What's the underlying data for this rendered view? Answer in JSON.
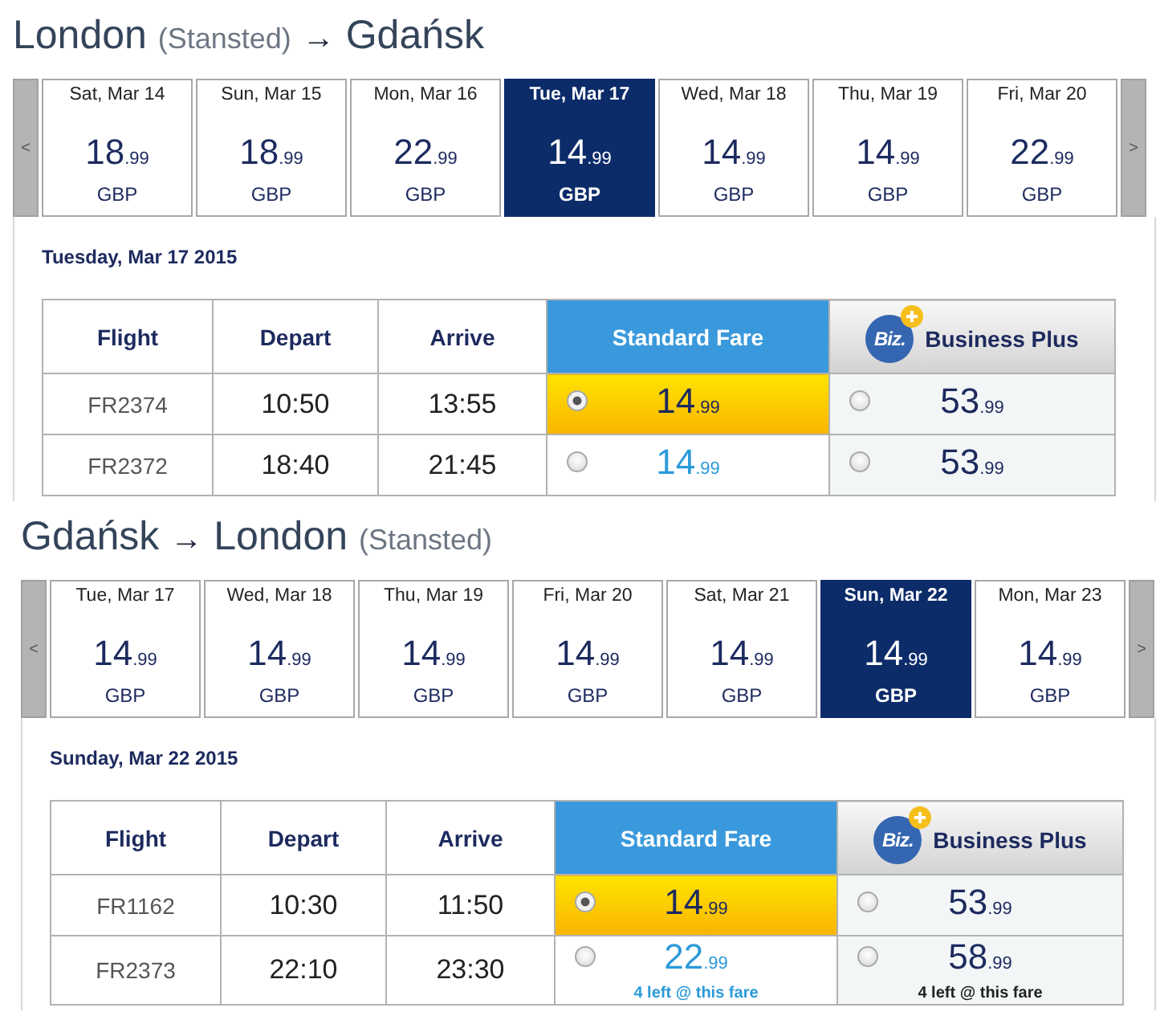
{
  "sections": [
    {
      "title": [
        {
          "kind": "city",
          "text": "London"
        },
        {
          "kind": "airport",
          "text": "(Stansted)"
        },
        {
          "kind": "arrow",
          "text": "→"
        },
        {
          "kind": "city",
          "text": "Gdańsk"
        }
      ],
      "prev_label": "<",
      "next_label": ">",
      "dates": [
        {
          "label": "Sat, Mar 14",
          "price": "18",
          "cents": ".99",
          "currency": "GBP",
          "selected": false
        },
        {
          "label": "Sun, Mar 15",
          "price": "18",
          "cents": ".99",
          "currency": "GBP",
          "selected": false
        },
        {
          "label": "Mon, Mar 16",
          "price": "22",
          "cents": ".99",
          "currency": "GBP",
          "selected": false
        },
        {
          "label": "Tue, Mar 17",
          "price": "14",
          "cents": ".99",
          "currency": "GBP",
          "selected": true
        },
        {
          "label": "Wed, Mar 18",
          "price": "14",
          "cents": ".99",
          "currency": "GBP",
          "selected": false
        },
        {
          "label": "Thu, Mar 19",
          "price": "14",
          "cents": ".99",
          "currency": "GBP",
          "selected": false
        },
        {
          "label": "Fri, Mar 20",
          "price": "22",
          "cents": ".99",
          "currency": "GBP",
          "selected": false
        }
      ],
      "day_heading": "Tuesday, Mar 17 2015",
      "columns": [
        {
          "label": "Flight",
          "kind": "info"
        },
        {
          "label": "Depart",
          "kind": "info"
        },
        {
          "label": "Arrive",
          "kind": "info"
        },
        {
          "label": "Standard Fare",
          "kind": "standard"
        },
        {
          "label": "Business Plus",
          "kind": "business",
          "logo_text": "Biz."
        }
      ],
      "rows": [
        {
          "flight": "FR2374",
          "depart": "10:50",
          "arrive": "13:55",
          "fares": [
            {
              "price": "14",
              "cents": ".99",
              "selected": true
            },
            {
              "price": "53",
              "cents": ".99",
              "selected": false
            }
          ]
        },
        {
          "flight": "FR2372",
          "depart": "18:40",
          "arrive": "21:45",
          "fares": [
            {
              "price": "14",
              "cents": ".99",
              "selected": false
            },
            {
              "price": "53",
              "cents": ".99",
              "selected": false
            }
          ]
        }
      ]
    },
    {
      "title": [
        {
          "kind": "city",
          "text": "Gdańsk"
        },
        {
          "kind": "arrow",
          "text": "→"
        },
        {
          "kind": "city",
          "text": "London"
        },
        {
          "kind": "airport",
          "text": "(Stansted)"
        }
      ],
      "prev_label": "<",
      "next_label": ">",
      "dates": [
        {
          "label": "Tue, Mar 17",
          "price": "14",
          "cents": ".99",
          "currency": "GBP",
          "selected": false
        },
        {
          "label": "Wed, Mar 18",
          "price": "14",
          "cents": ".99",
          "currency": "GBP",
          "selected": false
        },
        {
          "label": "Thu, Mar 19",
          "price": "14",
          "cents": ".99",
          "currency": "GBP",
          "selected": false
        },
        {
          "label": "Fri, Mar 20",
          "price": "14",
          "cents": ".99",
          "currency": "GBP",
          "selected": false
        },
        {
          "label": "Sat, Mar 21",
          "price": "14",
          "cents": ".99",
          "currency": "GBP",
          "selected": false
        },
        {
          "label": "Sun, Mar 22",
          "price": "14",
          "cents": ".99",
          "currency": "GBP",
          "selected": true
        },
        {
          "label": "Mon, Mar 23",
          "price": "14",
          "cents": ".99",
          "currency": "GBP",
          "selected": false
        }
      ],
      "day_heading": "Sunday, Mar 22 2015",
      "columns": [
        {
          "label": "Flight",
          "kind": "info"
        },
        {
          "label": "Depart",
          "kind": "info"
        },
        {
          "label": "Arrive",
          "kind": "info"
        },
        {
          "label": "Standard Fare",
          "kind": "standard"
        },
        {
          "label": "Business Plus",
          "kind": "business",
          "logo_text": "Biz."
        }
      ],
      "rows": [
        {
          "flight": "FR1162",
          "depart": "10:30",
          "arrive": "11:50",
          "fares": [
            {
              "price": "14",
              "cents": ".99",
              "selected": true
            },
            {
              "price": "53",
              "cents": ".99",
              "selected": false
            }
          ]
        },
        {
          "flight": "FR2373",
          "depart": "22:10",
          "arrive": "23:30",
          "fares": [
            {
              "price": "22",
              "cents": ".99",
              "selected": false,
              "note": "4 left @ this fare"
            },
            {
              "price": "58",
              "cents": ".99",
              "selected": false,
              "note": "4 left @ this fare"
            }
          ]
        }
      ]
    }
  ]
}
